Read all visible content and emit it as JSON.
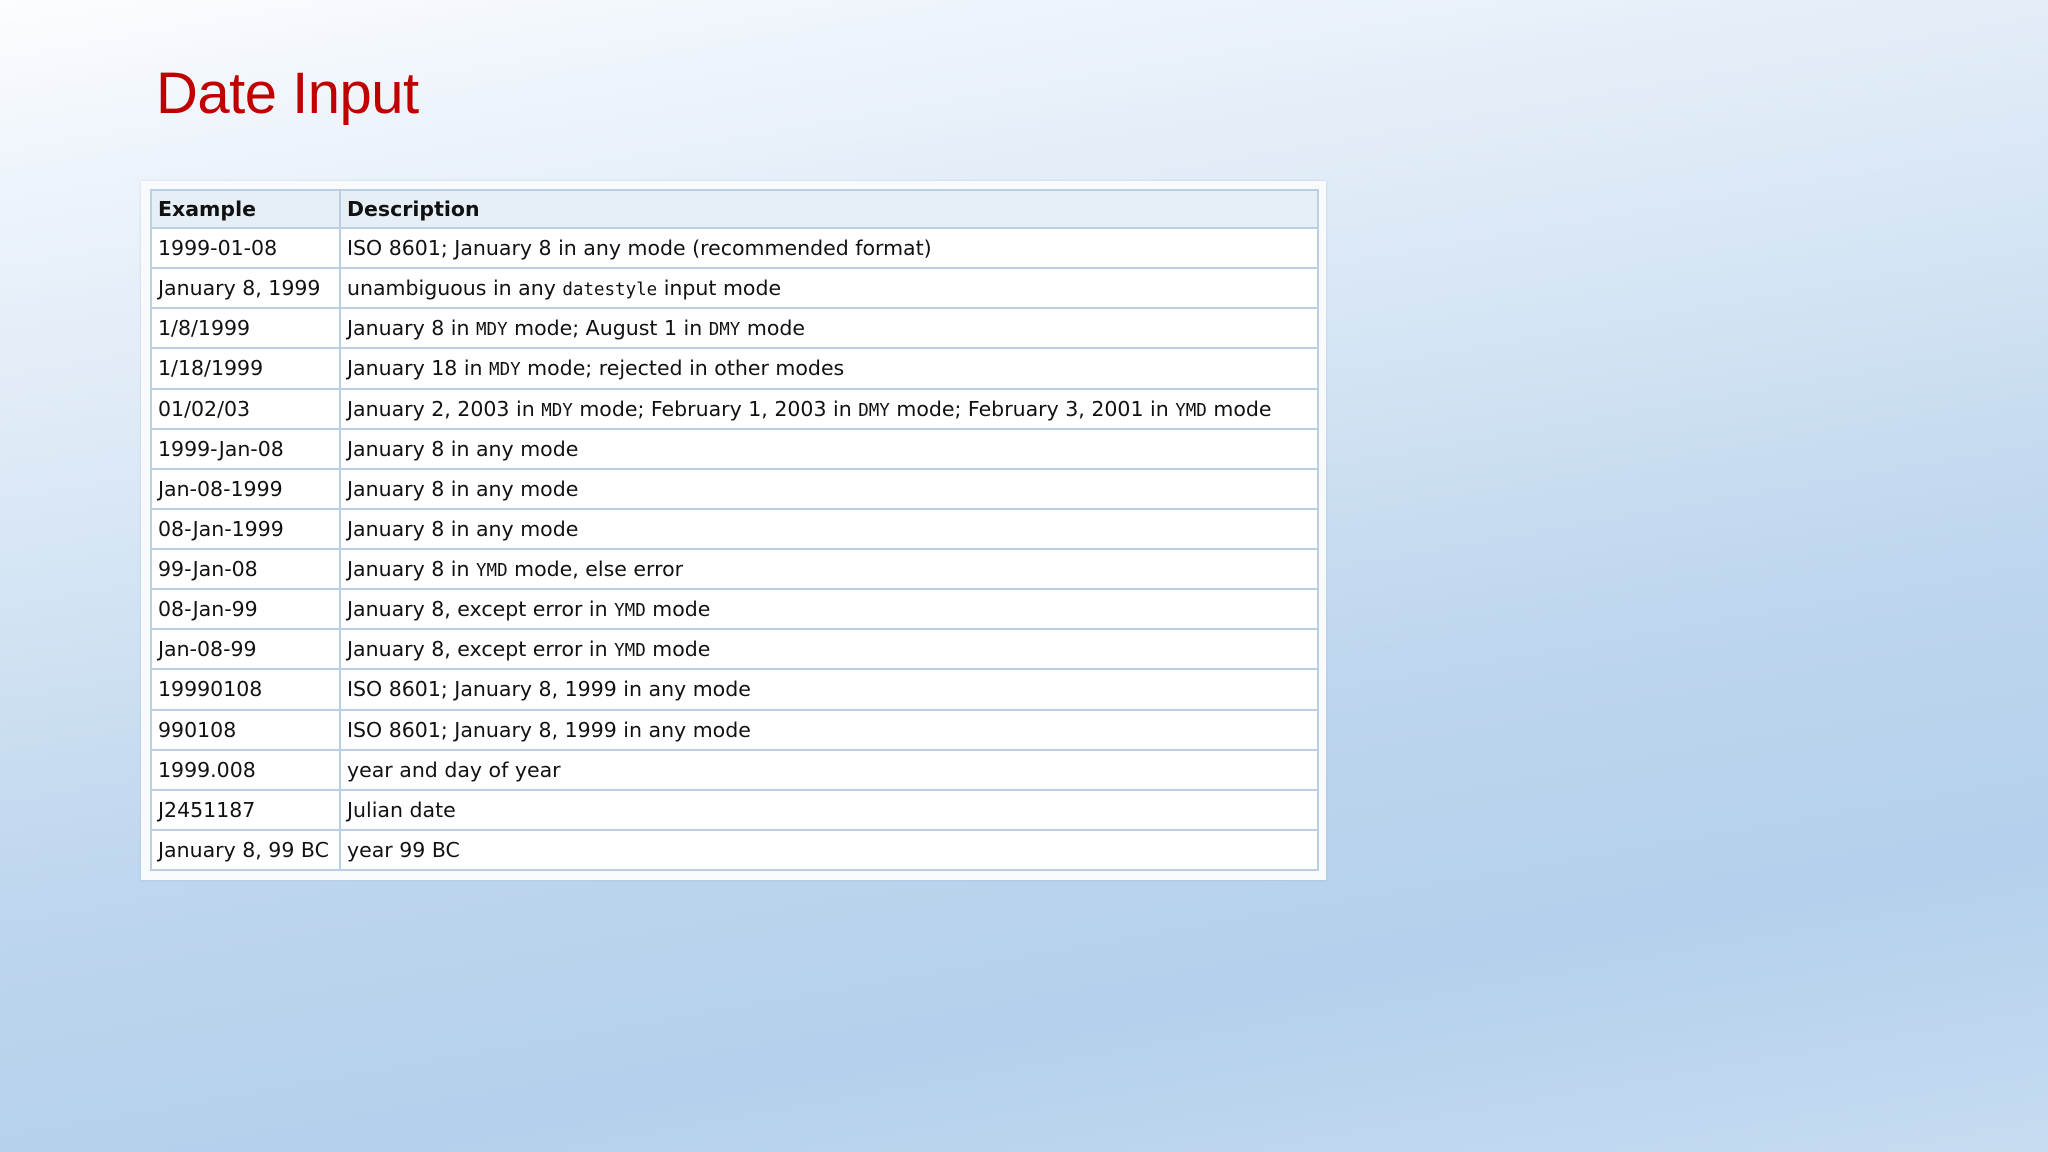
{
  "slide": {
    "title": "Date Input"
  },
  "table": {
    "headers": {
      "example": "Example",
      "description": "Description"
    },
    "rows": [
      {
        "example": "1999-01-08",
        "desc": [
          {
            "t": "ISO 8601; January 8 in any mode (recommended format)"
          }
        ]
      },
      {
        "example": "January 8, 1999",
        "desc": [
          {
            "t": "unambiguous in any "
          },
          {
            "t": "datestyle",
            "code": true
          },
          {
            "t": " input mode"
          }
        ]
      },
      {
        "example": "1/8/1999",
        "desc": [
          {
            "t": "January 8 in "
          },
          {
            "t": "MDY",
            "code": true
          },
          {
            "t": " mode; August 1 in "
          },
          {
            "t": "DMY",
            "code": true
          },
          {
            "t": " mode"
          }
        ]
      },
      {
        "example": "1/18/1999",
        "desc": [
          {
            "t": "January 18 in "
          },
          {
            "t": "MDY",
            "code": true
          },
          {
            "t": " mode; rejected in other modes"
          }
        ]
      },
      {
        "example": "01/02/03",
        "desc": [
          {
            "t": "January 2, 2003 in "
          },
          {
            "t": "MDY",
            "code": true
          },
          {
            "t": " mode; February 1, 2003 in "
          },
          {
            "t": "DMY",
            "code": true
          },
          {
            "t": " mode; February 3, 2001 in "
          },
          {
            "t": "YMD",
            "code": true
          },
          {
            "t": " mode"
          }
        ]
      },
      {
        "example": "1999-Jan-08",
        "desc": [
          {
            "t": "January 8 in any mode"
          }
        ]
      },
      {
        "example": "Jan-08-1999",
        "desc": [
          {
            "t": "January 8 in any mode"
          }
        ]
      },
      {
        "example": "08-Jan-1999",
        "desc": [
          {
            "t": "January 8 in any mode"
          }
        ]
      },
      {
        "example": "99-Jan-08",
        "desc": [
          {
            "t": "January 8 in "
          },
          {
            "t": "YMD",
            "code": true
          },
          {
            "t": " mode, else error"
          }
        ]
      },
      {
        "example": "08-Jan-99",
        "desc": [
          {
            "t": "January 8, except error in "
          },
          {
            "t": "YMD",
            "code": true
          },
          {
            "t": " mode"
          }
        ]
      },
      {
        "example": "Jan-08-99",
        "desc": [
          {
            "t": "January 8, except error in "
          },
          {
            "t": "YMD",
            "code": true
          },
          {
            "t": " mode"
          }
        ]
      },
      {
        "example": "19990108",
        "desc": [
          {
            "t": "ISO 8601; January 8, 1999 in any mode"
          }
        ]
      },
      {
        "example": "990108",
        "desc": [
          {
            "t": "ISO 8601; January 8, 1999 in any mode"
          }
        ]
      },
      {
        "example": "1999.008",
        "desc": [
          {
            "t": "year and day of year"
          }
        ]
      },
      {
        "example": "J2451187",
        "desc": [
          {
            "t": "Julian date"
          }
        ]
      },
      {
        "example": "January 8, 99 BC",
        "desc": [
          {
            "t": "year 99 BC"
          }
        ]
      }
    ]
  },
  "colors": {
    "title": "#c00000",
    "header_bg": "#e6eef6",
    "grid": "#b8cfe5"
  }
}
